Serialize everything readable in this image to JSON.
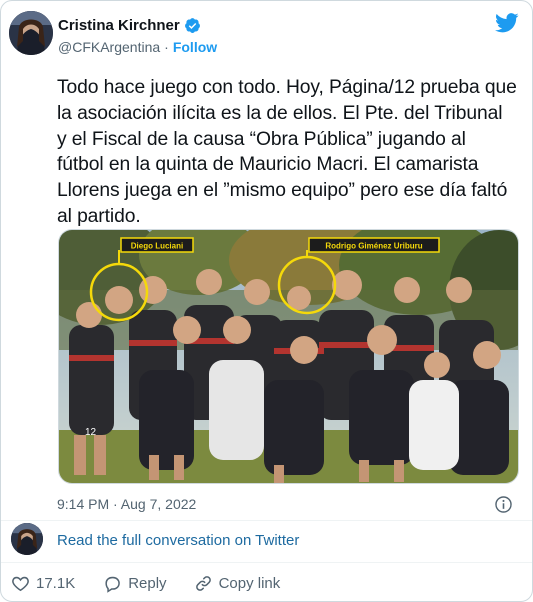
{
  "author": {
    "name": "Cristina Kirchner",
    "handle": "@CFKArgentina",
    "separator": "·",
    "follow_label": "Follow"
  },
  "tweet": {
    "text": "Todo hace juego con todo. Hoy, Página/12 prueba que la asociación ilícita es la de ellos. El Pte. del Tribunal y el Fiscal de la causa “Obra Pública” jugando al fútbol en la quinta de Mauricio Macri. El camarista Llorens juega en el ”mismo equipo” pero ese día faltó al partido.",
    "timestamp": "9:14 PM · Aug 7, 2022"
  },
  "photo": {
    "label_left": "Diego Luciani",
    "label_right": "Rodrigo Giménez Uriburu",
    "jersey_number": "12"
  },
  "conversation_link": "Read the full conversation on Twitter",
  "actions": {
    "likes": "17.1K",
    "reply": "Reply",
    "copy_link": "Copy link"
  },
  "colors": {
    "twitter_blue": "#1d9bf0",
    "highlight_yellow": "#f5d90a"
  },
  "icons": [
    "verified-badge-icon",
    "twitter-bird-icon",
    "info-icon",
    "heart-icon",
    "reply-icon",
    "link-icon"
  ]
}
